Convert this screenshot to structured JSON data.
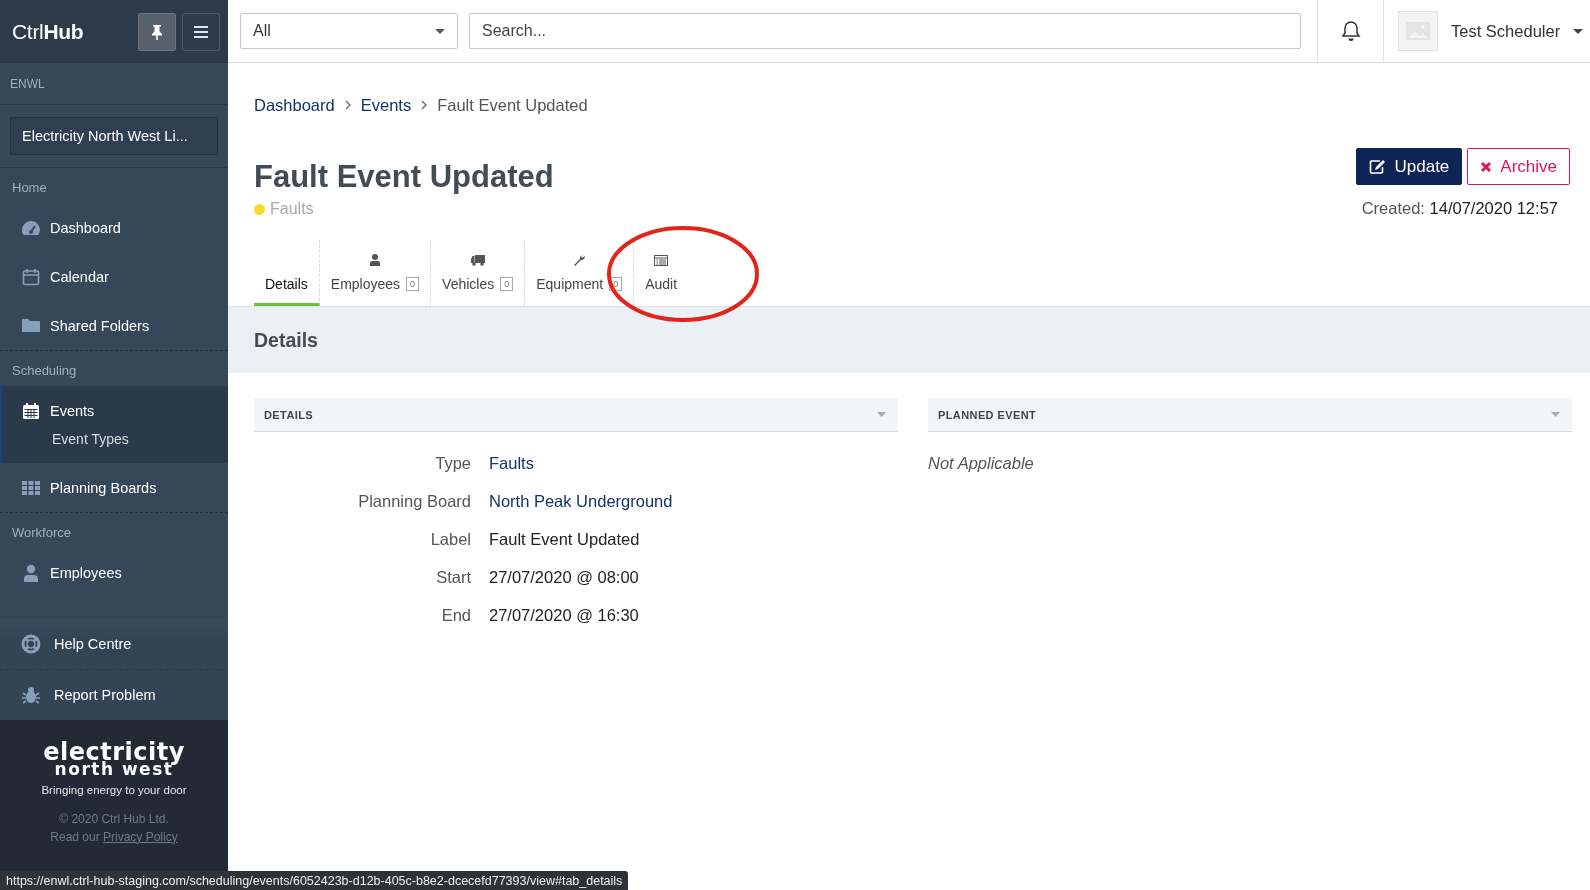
{
  "app": {
    "logo": "Ctrl**Hub**"
  },
  "sidebar": {
    "org_label": "ENWL",
    "org_selector": "Electricity North West Li...",
    "sections": [
      {
        "title": "Home",
        "items": [
          {
            "label": "Dashboard",
            "kind": "gauge",
            "selected": false
          },
          {
            "label": "Calendar",
            "kind": "calendar",
            "selected": false
          },
          {
            "label": "Shared Folders",
            "kind": "folder",
            "selected": false
          }
        ]
      },
      {
        "title": "Scheduling",
        "items": [
          {
            "label": "Events",
            "kind": "events",
            "selected": true,
            "children": [
              {
                "label": "Event Types",
                "selected": false
              }
            ]
          },
          {
            "label": "Planning Boards",
            "kind": "grid",
            "selected": false
          }
        ]
      },
      {
        "title": "Workforce",
        "items": [
          {
            "label": "Employees",
            "kind": "person",
            "selected": false
          }
        ]
      }
    ],
    "bottom_items": [
      {
        "label": "Help Centre",
        "kind": "lifebuoy"
      },
      {
        "label": "Report Problem",
        "kind": "bug"
      }
    ],
    "footer": {
      "logo_line_1": "electricity",
      "logo_line_2": "north west",
      "tagline": "Bringing energy to your door",
      "copyright": "© 2020 Ctrl Hub Ltd.",
      "privacy_prefix": "Read our",
      "privacy_link": "Privacy Policy"
    }
  },
  "topbar": {
    "filter": "All",
    "search_placeholder": "Search...",
    "user": "Test Scheduler"
  },
  "breadcrumb": [
    {
      "label": "Dashboard",
      "link": true
    },
    {
      "label": "Events",
      "link": true
    },
    {
      "label": "Fault Event Updated",
      "link": false
    }
  ],
  "title": "Fault Event Updated",
  "category": {
    "label": "Faults",
    "color": "#f7dc2a"
  },
  "actions": [
    {
      "label": "Update",
      "kind": "primary"
    },
    {
      "label": "Archive",
      "kind": "danger"
    }
  ],
  "created": {
    "label": "Created:",
    "value": "14/07/2020 12:57"
  },
  "tabs": [
    {
      "label": "Details",
      "kind": "none",
      "selected": true
    },
    {
      "label": "Employees",
      "kind": "person",
      "count": "0",
      "selected": false
    },
    {
      "label": "Vehicles",
      "kind": "truck",
      "count": "0",
      "selected": false
    },
    {
      "label": "Equipment",
      "kind": "wrench",
      "count": "0",
      "selected": false
    },
    {
      "label": "Audit",
      "kind": "list",
      "selected": false
    }
  ],
  "annotation": {
    "kind": "ellipse",
    "color": "#e3241b"
  },
  "section_heading": "Details",
  "panels": [
    {
      "title": "DETAILS",
      "rows": [
        {
          "label": "Type",
          "value": "Faults",
          "link": true
        },
        {
          "label": "Planning Board",
          "value": "North Peak Underground",
          "link": true
        },
        {
          "label": "Label",
          "value": "Fault Event Updated",
          "link": false
        },
        {
          "label": "Start",
          "value": "27/07/2020 @ 08:00",
          "link": false
        },
        {
          "label": "End",
          "value": "27/07/2020 @ 16:30",
          "link": false
        }
      ]
    },
    {
      "title": "PLANNED EVENT",
      "note": "Not Applicable"
    }
  ],
  "status_url": "https://enwl.ctrl-hub-staging.com/scheduling/events/6052423b-d12b-405c-b8e2-dcecefd77393/view#tab_details"
}
